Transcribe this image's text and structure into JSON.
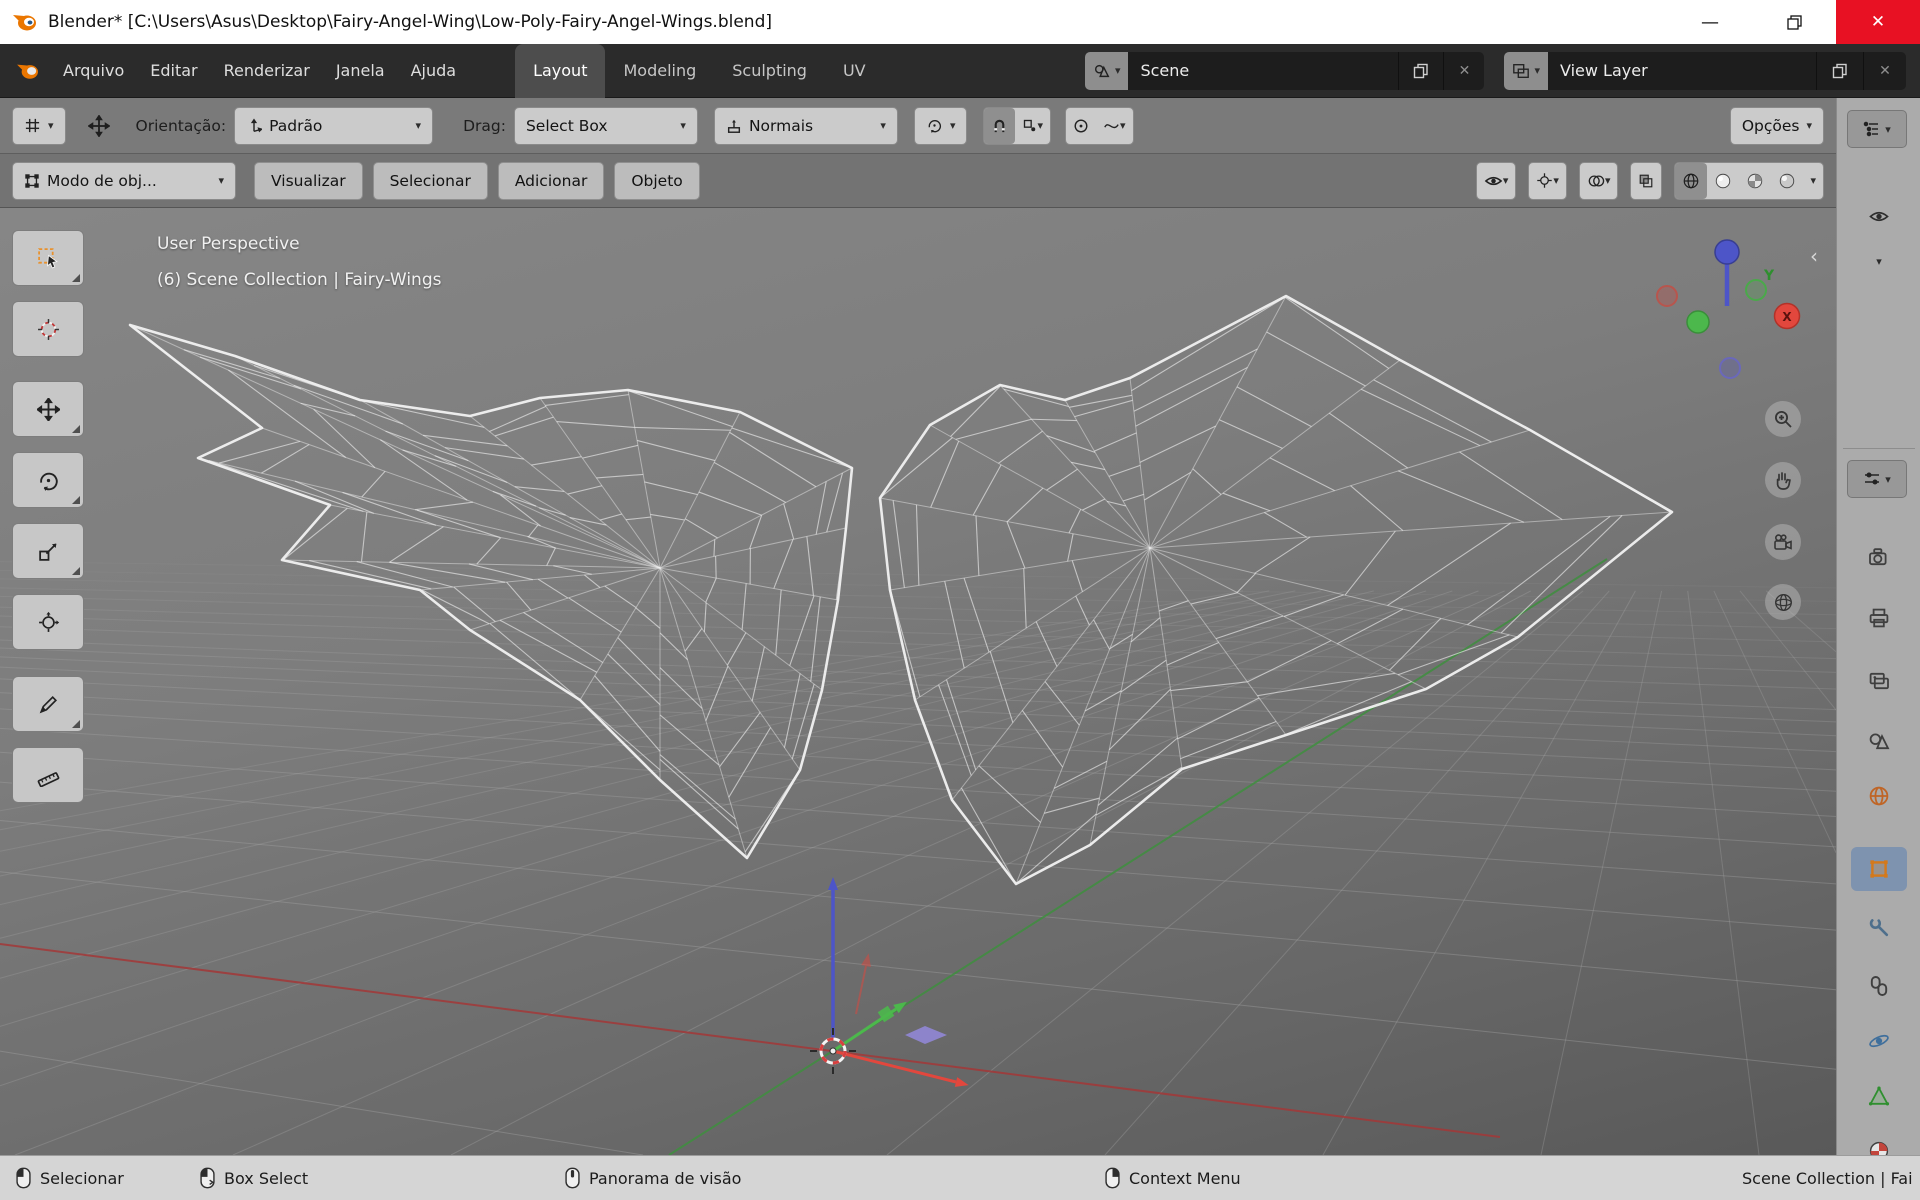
{
  "icons": {
    "chevron_down": "▾",
    "close": "✕",
    "minimize": "—",
    "collapse_left": "‹"
  },
  "titlebar": {
    "title": "Blender* [C:\\Users\\Asus\\Desktop\\Fairy-Angel-Wing\\Low-Poly-Fairy-Angel-Wings.blend]"
  },
  "menubar": {
    "menus": [
      "Arquivo",
      "Editar",
      "Renderizar",
      "Janela",
      "Ajuda"
    ],
    "tabs": [
      "Layout",
      "Modeling",
      "Sculpting",
      "UV"
    ],
    "active_tab": "Layout",
    "scene": {
      "value": "Scene"
    },
    "view_layer": {
      "value": "View Layer"
    }
  },
  "toolbar": {
    "orientation_label": "Orientação:",
    "orientation_value": "Padrão",
    "drag_label": "Drag:",
    "drag_value": "Select Box",
    "snap_value": "Normais",
    "options_label": "Opções"
  },
  "header2": {
    "mode_value": "Modo de obj...",
    "menus": [
      "Visualizar",
      "Selecionar",
      "Adicionar",
      "Objeto"
    ]
  },
  "viewport": {
    "overlay_line1": "User Perspective",
    "overlay_line2": "(6) Scene Collection | Fairy-Wings",
    "gizmo_labels": {
      "x": "X",
      "y": "Y"
    },
    "colors": {
      "wire": "#f1f1f1",
      "grid": "#a6a6a6",
      "axis_x": "#a33838",
      "axis_y": "#3f8f3f",
      "gizmo_x": "#e2473d",
      "gizmo_y": "#4cb84c",
      "gizmo_z": "#4d55c8",
      "cursor_red": "#d84040",
      "accent": "#e8912d"
    }
  },
  "statusbar": {
    "items": [
      {
        "label": "Selecionar"
      },
      {
        "label": "Box Select"
      },
      {
        "label": "Panorama de visão"
      },
      {
        "label": "Context Menu"
      }
    ],
    "right_text": "Scene Collection | Fai"
  }
}
